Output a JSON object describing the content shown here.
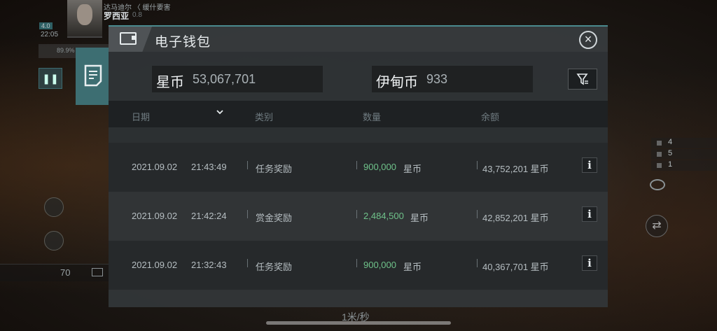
{
  "hud": {
    "pilot_top": "达马迪尔 〈 缓什要害",
    "pilot_name": "罗西亚",
    "pilot_sub": "0.8",
    "level": "4.0",
    "clock": "22:05",
    "stat_text": "89.9%",
    "crew_count": "70",
    "speed": "1米/秒",
    "right_counts": [
      "4",
      "5",
      "1"
    ]
  },
  "wallet": {
    "title": "电子钱包",
    "currencies": [
      {
        "name": "星币",
        "value": "53,067,701"
      },
      {
        "name": "伊甸币",
        "value": "933"
      }
    ],
    "columns": [
      "日期",
      "类别",
      "数量",
      "余额"
    ],
    "rows": [
      {
        "date": "2021.09.02",
        "time": "21:43:49",
        "category": "任务奖励",
        "amount": "900,000",
        "amount_unit": "星币",
        "balance": "43,752,201 星币"
      },
      {
        "date": "2021.09.02",
        "time": "21:42:24",
        "category": "赏金奖励",
        "amount": "2,484,500",
        "amount_unit": "星币",
        "balance": "42,852,201 星币"
      },
      {
        "date": "2021.09.02",
        "time": "21:32:43",
        "category": "任务奖励",
        "amount": "900,000",
        "amount_unit": "星币",
        "balance": "40,367,701 星币"
      }
    ],
    "info_glyph": "i"
  },
  "icons": {
    "close": "×"
  },
  "colors": {
    "accent": "#4a8a8e",
    "amount_green": "#6fc28a"
  }
}
